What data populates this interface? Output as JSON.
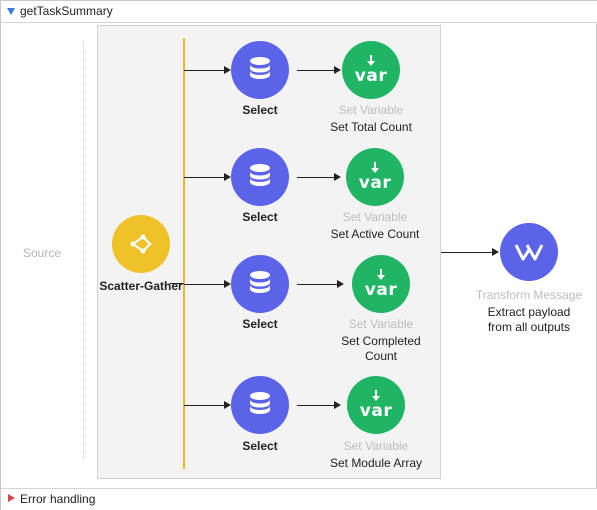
{
  "flow": {
    "name": "getTaskSummary"
  },
  "source": {
    "label": "Source"
  },
  "scatter_gather": {
    "label": "Scatter-Gather",
    "color": "#f0c22a"
  },
  "routes": [
    {
      "processor": {
        "label": "Select",
        "icon": "database-icon",
        "color": "#5b63e8"
      },
      "variable": {
        "type_label": "Set Variable",
        "name": "Set Total Count",
        "icon": "var-icon",
        "icon_text": "var",
        "color": "#1fb565"
      }
    },
    {
      "processor": {
        "label": "Select",
        "icon": "database-icon",
        "color": "#5b63e8"
      },
      "variable": {
        "type_label": "Set Variable",
        "name": "Set Active Count",
        "icon": "var-icon",
        "icon_text": "var",
        "color": "#1fb565"
      }
    },
    {
      "processor": {
        "label": "Select",
        "icon": "database-icon",
        "color": "#5b63e8"
      },
      "variable": {
        "type_label": "Set Variable",
        "name_lines": [
          "Set Completed",
          "Count"
        ],
        "icon": "var-icon",
        "icon_text": "var",
        "color": "#1fb565"
      }
    },
    {
      "processor": {
        "label": "Select",
        "icon": "database-icon",
        "color": "#5b63e8"
      },
      "variable": {
        "type_label": "Set Variable",
        "name": "Set Module Array",
        "icon": "var-icon",
        "icon_text": "var",
        "color": "#1fb565"
      }
    }
  ],
  "transform": {
    "type_label": "Transform Message",
    "name_lines": [
      "Extract payload",
      "from all outputs"
    ],
    "icon": "dataweave-icon",
    "color": "#5b63e8"
  },
  "error_handling": {
    "label": "Error handling"
  }
}
